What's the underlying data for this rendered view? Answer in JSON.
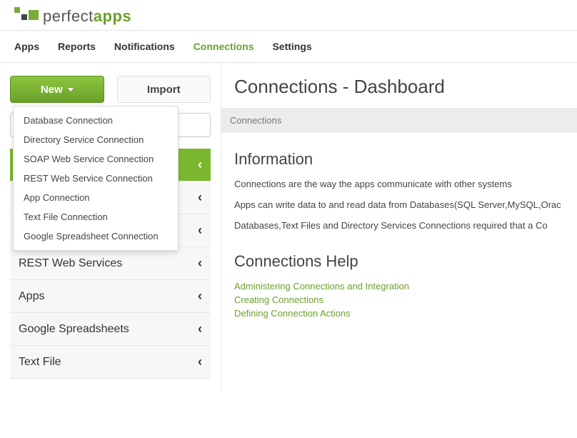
{
  "logo": {
    "text_light": "perfect",
    "text_bold": "apps"
  },
  "topnav": {
    "items": [
      {
        "label": "Apps"
      },
      {
        "label": "Reports"
      },
      {
        "label": "Notifications"
      },
      {
        "label": "Connections",
        "active": true
      },
      {
        "label": "Settings"
      }
    ]
  },
  "sidebar": {
    "new_label": "New",
    "import_label": "Import",
    "search_placeholder": "",
    "dropdown": [
      "Database Connection",
      "Directory Service Connection",
      "SOAP Web Service Connection",
      "REST Web Service Connection",
      "App Connection",
      "Text File Connection",
      "Google Spreadsheet Connection"
    ],
    "accordion": [
      {
        "title": "",
        "active": true
      },
      {
        "title": ""
      },
      {
        "title": ""
      },
      {
        "title": "REST Web Services"
      },
      {
        "title": "Apps"
      },
      {
        "title": "Google Spreadsheets"
      },
      {
        "title": "Text File"
      }
    ]
  },
  "main": {
    "title": "Connections - Dashboard",
    "breadcrumb": "Connections",
    "info_heading": "Information",
    "info_p1": "Connections are the way the apps communicate with other systems",
    "info_p2": "Apps can write data to and read data from Databases(SQL Server,MySQL,Orac",
    "info_p3": "Databases,Text Files and Directory Services Connections required that a Co",
    "help_heading": "Connections Help",
    "help_links": [
      "Administering Connections and Integration",
      "Creating Connections",
      "Defining Connection Actions"
    ]
  }
}
